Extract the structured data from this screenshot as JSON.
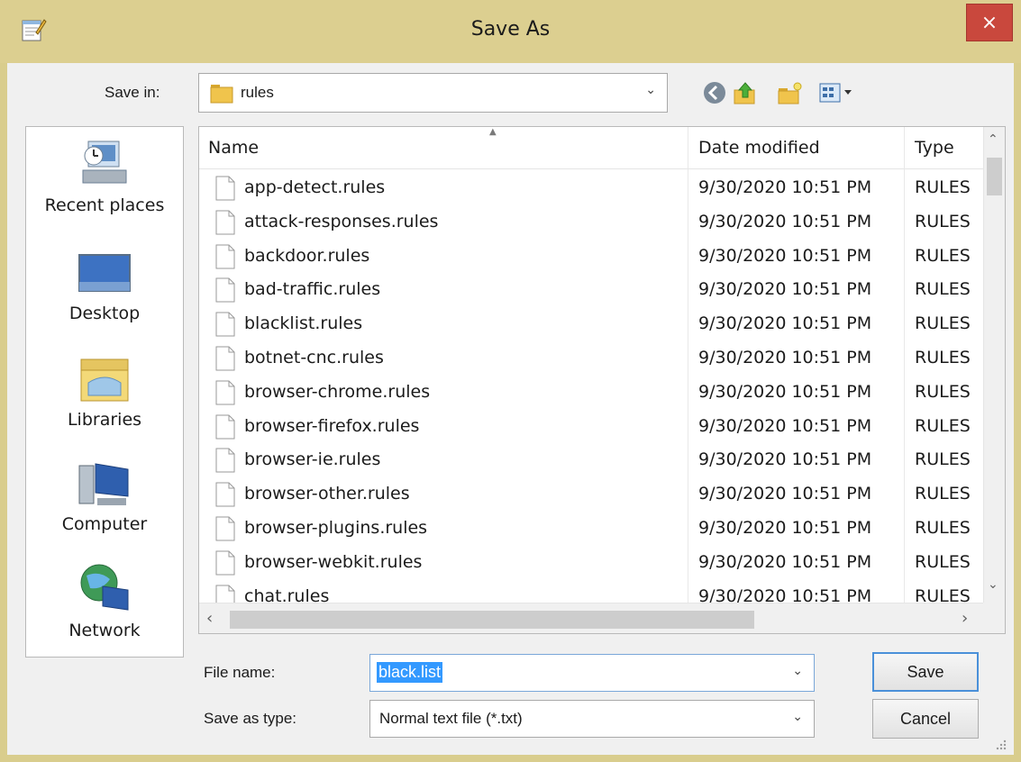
{
  "window": {
    "title": "Save As",
    "close_label": "×"
  },
  "save_in": {
    "label": "Save in:",
    "value": "rules"
  },
  "toolbar": {
    "icons": [
      "back-icon",
      "up-folder-icon",
      "new-folder-icon",
      "view-menu-icon"
    ]
  },
  "places": [
    {
      "label": "Recent places",
      "icon": "recent-places-icon"
    },
    {
      "label": "Desktop",
      "icon": "desktop-icon"
    },
    {
      "label": "Libraries",
      "icon": "libraries-icon"
    },
    {
      "label": "Computer",
      "icon": "computer-icon"
    },
    {
      "label": "Network",
      "icon": "network-icon"
    }
  ],
  "file_list": {
    "columns": {
      "name": "Name",
      "date": "Date modified",
      "type": "Type"
    },
    "files": [
      {
        "name": "app-detect.rules",
        "date": "9/30/2020 10:51 PM",
        "type": "RULES"
      },
      {
        "name": "attack-responses.rules",
        "date": "9/30/2020 10:51 PM",
        "type": "RULES"
      },
      {
        "name": "backdoor.rules",
        "date": "9/30/2020 10:51 PM",
        "type": "RULES"
      },
      {
        "name": "bad-traffic.rules",
        "date": "9/30/2020 10:51 PM",
        "type": "RULES"
      },
      {
        "name": "blacklist.rules",
        "date": "9/30/2020 10:51 PM",
        "type": "RULES"
      },
      {
        "name": "botnet-cnc.rules",
        "date": "9/30/2020 10:51 PM",
        "type": "RULES"
      },
      {
        "name": "browser-chrome.rules",
        "date": "9/30/2020 10:51 PM",
        "type": "RULES"
      },
      {
        "name": "browser-firefox.rules",
        "date": "9/30/2020 10:51 PM",
        "type": "RULES"
      },
      {
        "name": "browser-ie.rules",
        "date": "9/30/2020 10:51 PM",
        "type": "RULES"
      },
      {
        "name": "browser-other.rules",
        "date": "9/30/2020 10:51 PM",
        "type": "RULES"
      },
      {
        "name": "browser-plugins.rules",
        "date": "9/30/2020 10:51 PM",
        "type": "RULES"
      },
      {
        "name": "browser-webkit.rules",
        "date": "9/30/2020 10:51 PM",
        "type": "RULES"
      },
      {
        "name": "chat.rules",
        "date": "9/30/2020 10:51 PM",
        "type": "RULES"
      }
    ]
  },
  "form": {
    "file_name_label": "File name:",
    "file_name_value": "black.list",
    "save_as_type_label": "Save as type:",
    "save_as_type_value": "Normal text file (*.txt)"
  },
  "buttons": {
    "save": "Save",
    "cancel": "Cancel"
  },
  "colors": {
    "title_bar": "#dccf90",
    "close": "#c9483d",
    "selection": "#3399ff"
  }
}
